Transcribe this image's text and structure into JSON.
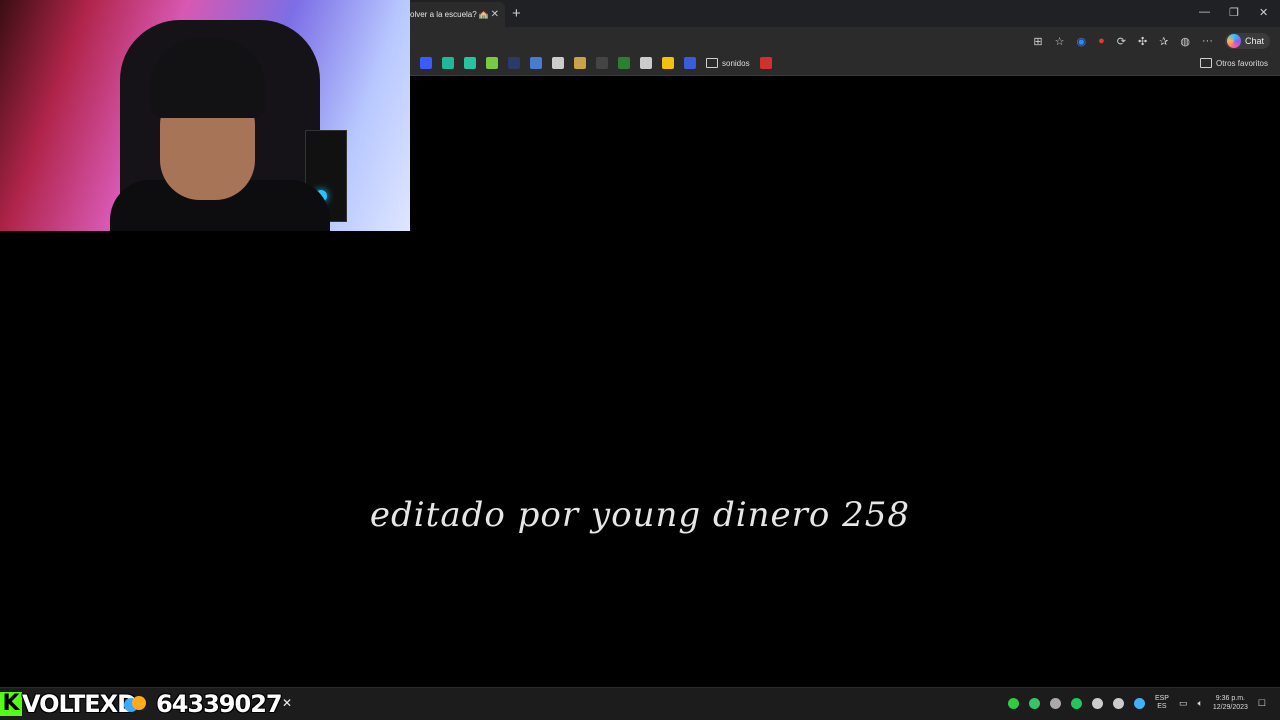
{
  "browser": {
    "tab_title": "olver a la escuela? 🏫",
    "tab_close": "✕",
    "new_tab": "+",
    "window_controls": {
      "minimize": "—",
      "maximize": "❐",
      "close": "✕"
    },
    "toolbar": {
      "chat_label": "Chat",
      "more": "···"
    },
    "favorites": {
      "folder_label": "sonidos",
      "other_label": "Otros favoritos",
      "icon_colors": [
        "#3a5bff",
        "#1fb89a",
        "#27c4a0",
        "#7ac943",
        "#2b3a66",
        "#4a7bd1",
        "#cccccc",
        "#caa24a",
        "#444444",
        "#2e7d32",
        "#cccccc",
        "#f4c20d",
        "#3b5bdb",
        "#d32f2f"
      ]
    }
  },
  "main": {
    "caption": "editado por young dinero 258"
  },
  "overlay": {
    "channel_name": "VOLTEXD",
    "kick_letter": "K",
    "coin_count": "64339027"
  },
  "taskbar": {
    "language": {
      "top": "ESP",
      "bottom": "ES"
    },
    "clock": {
      "time": "9:36 p.m.",
      "date": "12/29/2023"
    },
    "tray_icon_colors": [
      "#2ecc40",
      "#35c46a",
      "#aaaaaa",
      "#22c55e",
      "#cccccc",
      "#cccccc",
      "#3bb3ff"
    ]
  }
}
